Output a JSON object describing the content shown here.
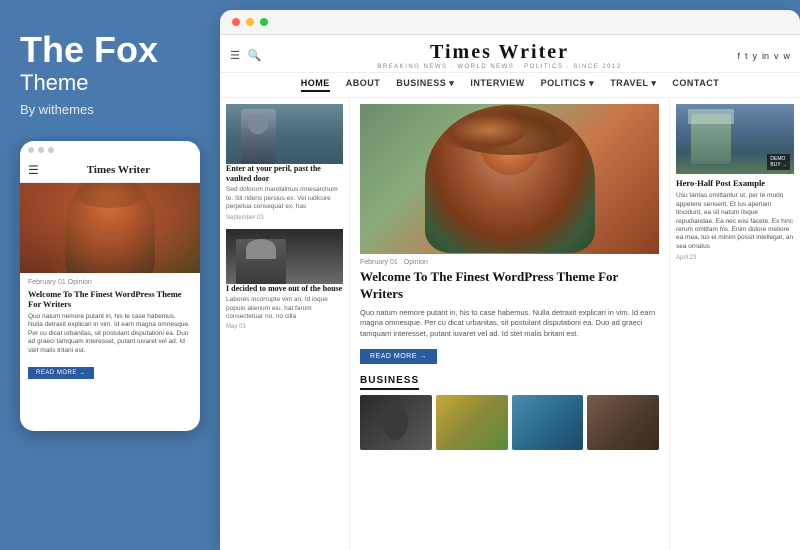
{
  "left": {
    "theme_name": "The Fox",
    "theme_subtitle": "Theme",
    "by_text": "By withemes"
  },
  "mobile": {
    "dots": [
      "dot1",
      "dot2",
      "dot3"
    ],
    "nav_icon": "☰",
    "title": "Times Writer",
    "meta": "February 01   Opinion",
    "article_title": "Welcome To The Finest WordPress Theme For Writers",
    "article_body": "Quo natum nemore putant in, his te case habemus. Nulla detraxit explicari in vim. Id earn magna omnesque. Per cu dicat urbanitas, sit postulant disputationi ea. Duo ad graeci tamquam interesset, putant iuvaret vel ad. Id stet malis tritani est.",
    "read_more": "READ MORE →"
  },
  "desktop": {
    "browser_dots": [
      "red",
      "yellow",
      "green"
    ],
    "header": {
      "menu_icon": "☰",
      "search_icon": "🔍",
      "site_name": "Times Writer",
      "tagline": "BREAKING NEWS · WORLD NEWS · POLITICS · SINCE 2012",
      "social_icons": [
        "f",
        "t",
        "y",
        "in",
        "v",
        "w"
      ]
    },
    "nav": {
      "items": [
        {
          "label": "HOME",
          "active": true
        },
        {
          "label": "ABOUT",
          "active": false
        },
        {
          "label": "BUSINESS ▾",
          "active": false
        },
        {
          "label": "INTERVIEW",
          "active": false
        },
        {
          "label": "POLITICS ▾",
          "active": false
        },
        {
          "label": "TRAVEL ▾",
          "active": false
        },
        {
          "label": "CONTACT",
          "active": false
        }
      ]
    },
    "col_left": {
      "card1": {
        "title": "Enter at your peril, past the vaulted door",
        "body": "Sed dolorum mandalmus mnesarchum te. Sit ridens persius ex. Vel iudicure perpetua consequat ex, has",
        "date": "September 03"
      },
      "card2": {
        "title": "I decided to move out of the house",
        "body": "Labores incorrupte vim an. Id ioque populo alienum eiu. hat farum consectetuar no, no cilla",
        "date": "May 03"
      }
    },
    "col_center": {
      "hero": {
        "meta_date": "February 01",
        "meta_category": "Opinion",
        "title": "Welcome To The Finest WordPress Theme For Writers",
        "body": "Quo natum nemore putant in, his to case habemus. Nulla detraxit explicari in vim. Id earn magna omnesque. Per cu dicat urbanitas, sit postulant disputationi ea. Duo ad graeci tamquam interesset, putant iuvaret vel ad. Id stet malis britani est.",
        "read_more": "READ MORE →"
      },
      "business_section": {
        "label": "BUSINESS",
        "thumbs": [
          "thumb1",
          "thumb2",
          "thumb3",
          "thumb4"
        ]
      }
    },
    "col_right": {
      "demo_badge": "DEMO\nBUY →",
      "article_title": "Hero-Half Post Example",
      "article_body": "Usu tantas omittantur ut, per te modo appetere senserit. Et ius aperiam tincidunt, ea sit natum lisque repudiandae. Ea nec wisi facete. Ex hinc rerum omittam his. Enim dolore meliore ea mea, lus ei minim possit intellegat, an sea ornatus",
      "article_date": "April 23"
    }
  }
}
